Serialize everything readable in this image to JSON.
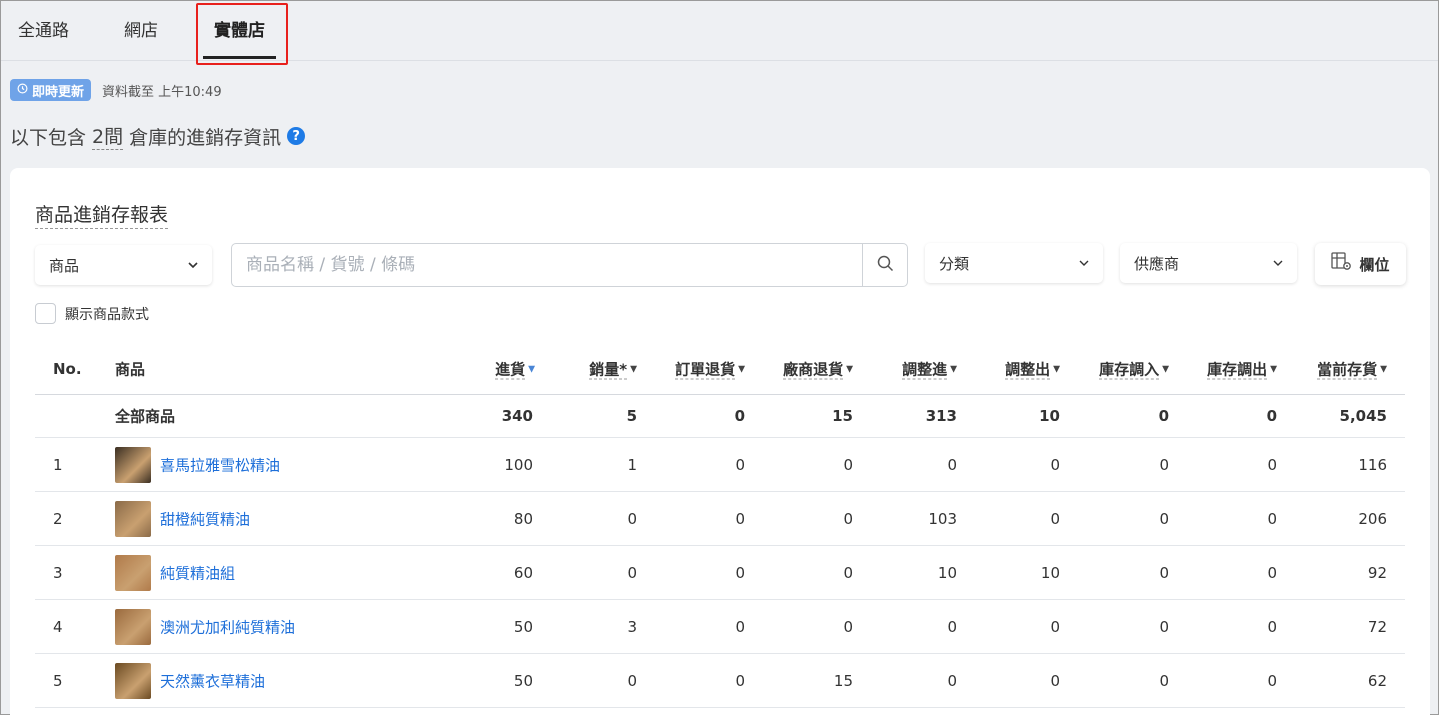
{
  "tabs": [
    "全通路",
    "網店",
    "實體店"
  ],
  "update": {
    "badge": "即時更新",
    "time": "資料截至 上午10:49"
  },
  "heading": {
    "prefix": "以下包含",
    "count": "2間",
    "suffix": "倉庫的進銷存資訊"
  },
  "card": {
    "title": "商品進銷存報表",
    "product_select": "商品",
    "search_placeholder": "商品名稱 / 貨號 / 條碼",
    "category_select": "分類",
    "supplier_select": "供應商",
    "columns_button": "欄位",
    "show_variants": "顯示商品款式"
  },
  "table": {
    "headers": [
      "No.",
      "商品",
      "進貨",
      "銷量*",
      "訂單退貨",
      "廠商退貨",
      "調整進",
      "調整出",
      "庫存調入",
      "庫存調出",
      "當前存貨"
    ],
    "total": {
      "label": "全部商品",
      "values": [
        "340",
        "5",
        "0",
        "15",
        "313",
        "10",
        "0",
        "0",
        "5,045"
      ]
    },
    "rows": [
      {
        "no": "1",
        "name": "喜馬拉雅雪松精油",
        "values": [
          "100",
          "1",
          "0",
          "0",
          "0",
          "0",
          "0",
          "0",
          "116"
        ],
        "thumb": "#3a2e22"
      },
      {
        "no": "2",
        "name": "甜橙純質精油",
        "values": [
          "80",
          "0",
          "0",
          "0",
          "103",
          "0",
          "0",
          "0",
          "206"
        ],
        "thumb": "#8a6a48"
      },
      {
        "no": "3",
        "name": "純質精油組",
        "values": [
          "60",
          "0",
          "0",
          "0",
          "10",
          "10",
          "0",
          "0",
          "92"
        ],
        "thumb": "#b07a4a"
      },
      {
        "no": "4",
        "name": "澳洲尤加利純質精油",
        "values": [
          "50",
          "3",
          "0",
          "0",
          "0",
          "0",
          "0",
          "0",
          "72"
        ],
        "thumb": "#9a6a3e"
      },
      {
        "no": "5",
        "name": "天然薰衣草精油",
        "values": [
          "50",
          "0",
          "0",
          "15",
          "0",
          "0",
          "0",
          "0",
          "62"
        ],
        "thumb": "#6a4a22"
      }
    ]
  },
  "colors": {
    "accent": "#1e6fd9",
    "badge": "#6fa3e8",
    "highlight": "#e8201c"
  }
}
